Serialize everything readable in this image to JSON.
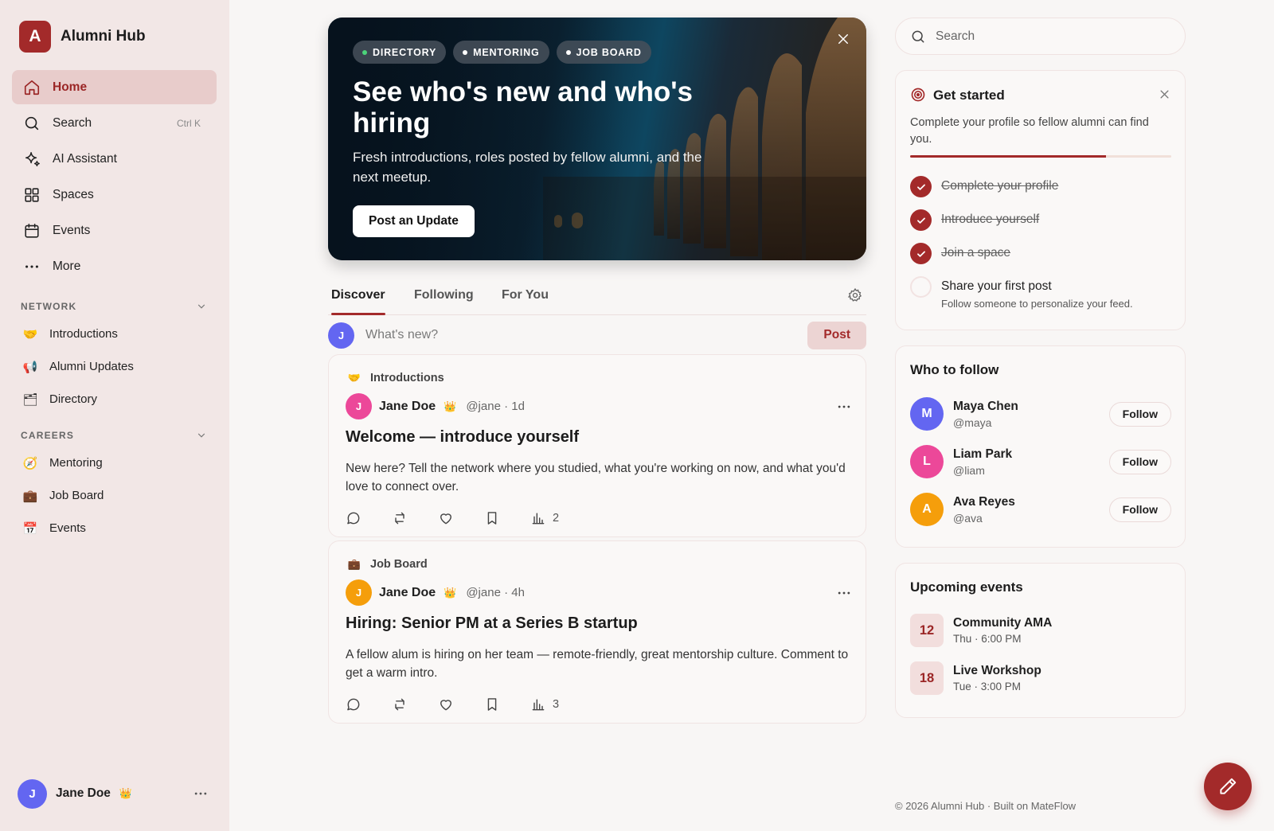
{
  "app": {
    "logo_letter": "A",
    "name": "Alumni Hub"
  },
  "nav": [
    {
      "label": "Home",
      "icon": "home-icon",
      "active": true
    },
    {
      "label": "Search",
      "icon": "search-icon",
      "shortcut": "Ctrl K"
    },
    {
      "label": "AI Assistant",
      "icon": "sparkle-icon"
    },
    {
      "label": "Spaces",
      "icon": "grid-icon"
    },
    {
      "label": "Events",
      "icon": "calendar-icon"
    },
    {
      "label": "More",
      "icon": "dots-icon"
    }
  ],
  "network": {
    "title": "NETWORK",
    "items": [
      {
        "label": "Introductions",
        "icon": "handshake-emoji",
        "glyph": "🤝"
      },
      {
        "label": "Alumni Updates",
        "icon": "megaphone-emoji",
        "glyph": "📢"
      },
      {
        "label": "Directory",
        "icon": "card-index-emoji",
        "glyph": "🗂"
      }
    ]
  },
  "careers": {
    "title": "CAREERS",
    "items": [
      {
        "label": "Mentoring",
        "icon": "compass-emoji",
        "glyph": "🧭"
      },
      {
        "label": "Job Board",
        "icon": "briefcase-emoji",
        "glyph": "💼"
      },
      {
        "label": "Events",
        "icon": "calendar-emoji",
        "glyph": "📅"
      }
    ]
  },
  "user": {
    "initial": "J",
    "name": "Jane Doe",
    "badge": "👑",
    "avatar_color": "#6366f1"
  },
  "hero": {
    "chips": [
      "DIRECTORY",
      "MENTORING",
      "JOB BOARD"
    ],
    "title": "See who's new and who's hiring",
    "subtitle": "Fresh introductions, roles posted by fellow alumni, and the next meetup.",
    "button": "Post an Update"
  },
  "tabs": [
    "Discover",
    "Following",
    "For You"
  ],
  "composer": {
    "initial": "J",
    "placeholder": "What's new?",
    "button": "Post"
  },
  "posts": [
    {
      "space": "Introductions",
      "space_glyph": "🤝",
      "initial": "J",
      "avatar_color": "#ec4899",
      "author": "Jane Doe",
      "badge": "👑",
      "meta": "@jane · 1d",
      "title": "Welcome — introduce yourself",
      "body": "New here? Tell the network where you studied, what you're working on now, and what you'd love to connect over.",
      "views": "2"
    },
    {
      "space": "Job Board",
      "space_glyph": "💼",
      "initial": "J",
      "avatar_color": "#f59e0b",
      "author": "Jane Doe",
      "badge": "👑",
      "meta": "@jane · 4h",
      "title": "Hiring: Senior PM at a Series B startup",
      "body": "A fellow alum is hiring on her team — remote-friendly, great mentorship culture. Comment to get a warm intro.",
      "views": "3"
    }
  ],
  "search": {
    "placeholder": "Search"
  },
  "get_started": {
    "title": "Get started",
    "description": "Complete your profile so fellow alumni can find you.",
    "progress": 0.75,
    "tasks": [
      {
        "label": "Complete your profile",
        "done": true
      },
      {
        "label": "Introduce yourself",
        "done": true
      },
      {
        "label": "Join a space",
        "done": true
      },
      {
        "label": "Share your first post",
        "done": false,
        "hint": "Follow someone to personalize your feed."
      }
    ]
  },
  "who_to_follow": {
    "title": "Who to follow",
    "people": [
      {
        "initial": "M",
        "name": "Maya Chen",
        "handle": "@maya",
        "color": "#6366f1",
        "button": "Follow"
      },
      {
        "initial": "L",
        "name": "Liam Park",
        "handle": "@liam",
        "color": "#ec4899",
        "button": "Follow"
      },
      {
        "initial": "A",
        "name": "Ava Reyes",
        "handle": "@ava",
        "color": "#f59e0b",
        "button": "Follow"
      }
    ]
  },
  "upcoming_events": {
    "title": "Upcoming events",
    "events": [
      {
        "day": "12",
        "name": "Community AMA",
        "time": "Thu · 6:00 PM"
      },
      {
        "day": "18",
        "name": "Live Workshop",
        "time": "Tue · 3:00 PM"
      }
    ]
  },
  "footer": "© 2026 Alumni Hub · Built on MateFlow",
  "colors": {
    "accent": "#a32a2a",
    "sidebar_bg": "#f2e7e6",
    "page_bg": "#f8f6f5"
  }
}
